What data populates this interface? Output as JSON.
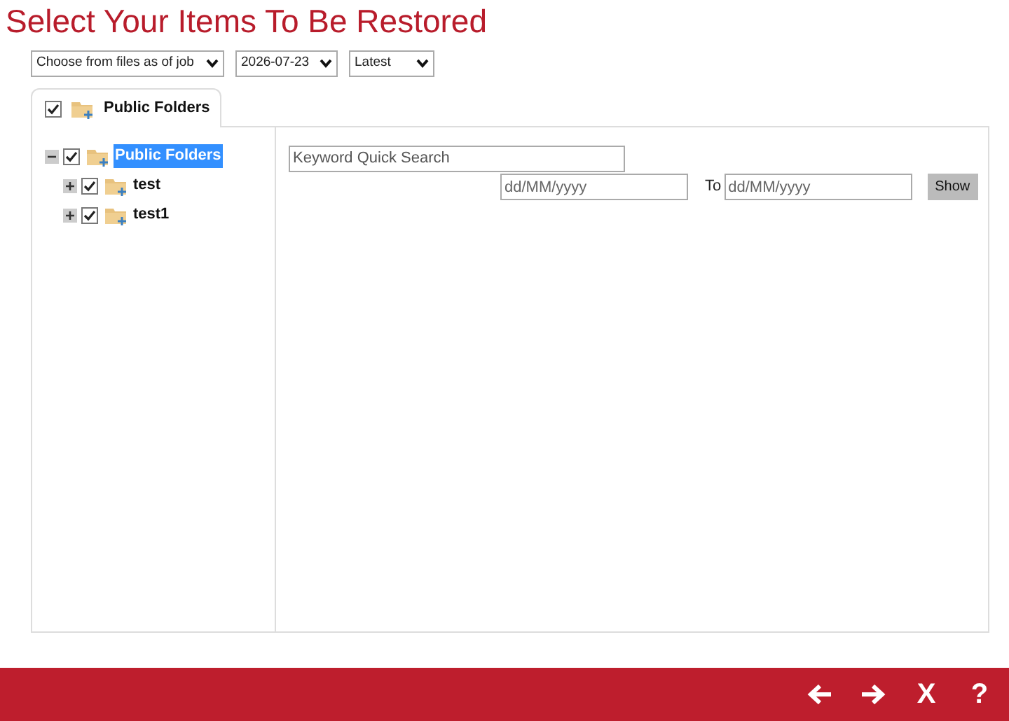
{
  "title": "Select Your Items To Be Restored",
  "dropdowns": [
    {
      "value": "Choose from files as of job"
    },
    {
      "value": "2026-07-23"
    },
    {
      "value": "Latest"
    }
  ],
  "tab": {
    "label": "Public Folders",
    "checked": true,
    "selected": true
  },
  "tree": [
    {
      "label": "Public Folders",
      "checked": true,
      "expanded": true,
      "selected": true,
      "children": [
        {
          "label": "test",
          "checked": true,
          "expanded": false,
          "selected": false
        },
        {
          "label": "test1",
          "checked": true,
          "expanded": false,
          "selected": false
        }
      ]
    }
  ],
  "search": {
    "placeholder": "Keyword Quick Search"
  },
  "date_from": {
    "placeholder": "dd/MM/yyyy"
  },
  "to_label": "To",
  "date_to": {
    "placeholder": "dd/MM/yyyy"
  },
  "show_button": "Show",
  "footer": [
    {
      "kind": "back"
    },
    {
      "kind": "forward"
    },
    {
      "kind": "text",
      "label": "X"
    },
    {
      "kind": "text",
      "label": "?"
    }
  ]
}
